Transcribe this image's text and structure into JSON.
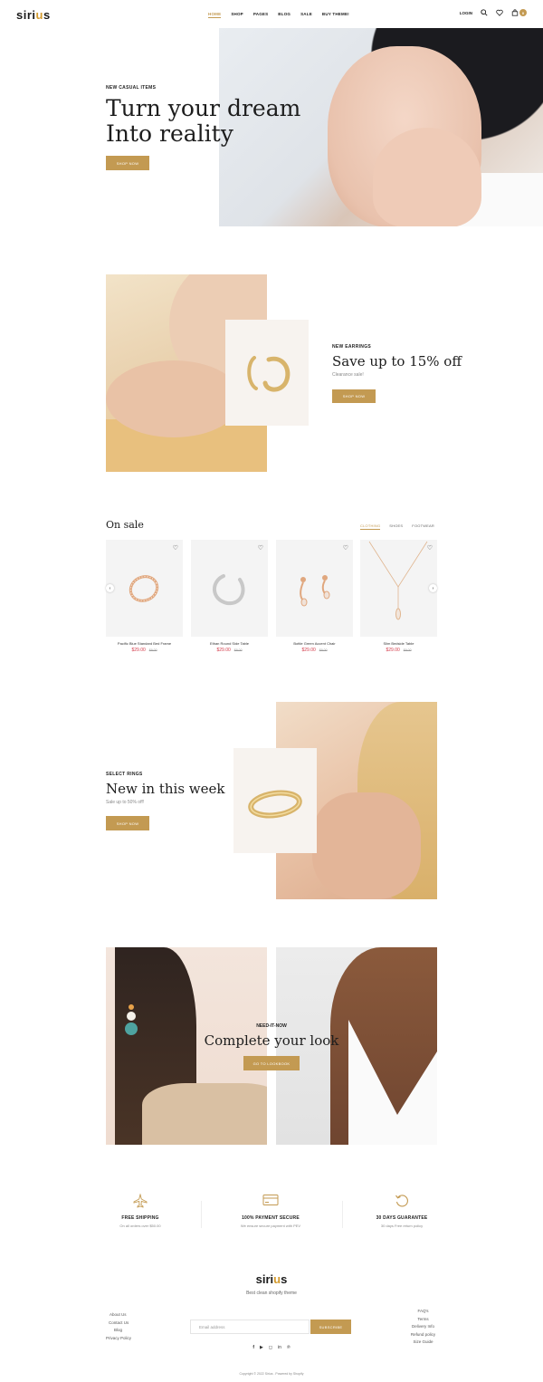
{
  "header": {
    "logo_text": "sirius",
    "logo_accent_color": "#d39a2d",
    "nav": [
      "HOME",
      "SHOP",
      "PAGES",
      "BLOG",
      "SALE",
      "BUY THEME!"
    ],
    "active_nav": "HOME",
    "login_label": "LOGIN",
    "cart_count": "0",
    "icons": [
      "search-icon",
      "heart-icon",
      "bag-icon"
    ]
  },
  "hero": {
    "eyebrow": "NEW CASUAL ITEMS",
    "title_line1": "Turn your dream",
    "title_line2": "Into reality",
    "button": "SHOP NOW"
  },
  "promo_earrings": {
    "eyebrow": "NEW EARRINGS",
    "title": "Save up to 15% off",
    "subtitle": "Clearance sale!",
    "button": "SHOP NOW"
  },
  "on_sale": {
    "title": "On sale",
    "tabs": [
      "CLOTHING",
      "SHOES",
      "FOOTWEAR"
    ],
    "active_tab": "CLOTHING",
    "products": [
      {
        "name": "Pacific Blue Standard Bed Frame",
        "price": "$29.00",
        "old_price": "$9.00"
      },
      {
        "name": "Ethan Round Side Table",
        "price": "$29.00",
        "old_price": "$9.00"
      },
      {
        "name": "Bottle Green Accent Chair",
        "price": "$29.00",
        "old_price": "$9.00"
      },
      {
        "name": "Slim Bedside Table",
        "price": "$29.00",
        "old_price": "$9.00"
      }
    ]
  },
  "new_week": {
    "eyebrow": "SELECT RINGS",
    "title": "New in this week",
    "subtitle": "Sale up to 50% off!",
    "button": "SHOP NOW"
  },
  "lookbook": {
    "eyebrow": "NEED-IT-NOW",
    "title": "Complete your look",
    "button": "GO TO LOOKBOOK"
  },
  "features": [
    {
      "icon": "plane-icon",
      "title": "FREE SHIPPING",
      "subtitle": "On all orders over $50.00"
    },
    {
      "icon": "credit-card-icon",
      "title": "100% PAYMENT SECURE",
      "subtitle": "We ensure secure payment with PEV"
    },
    {
      "icon": "refresh-icon",
      "title": "30 DAYS GUARANTEE",
      "subtitle": "30 days Free return policy"
    }
  ],
  "footer": {
    "logo_text": "sirius",
    "tagline": "Best clean shopify theme",
    "links_left": [
      "About Us",
      "Contact Us",
      "Blog",
      "Privacy Policy"
    ],
    "email_placeholder": "Email address",
    "subscribe": "SUBSCRIBE",
    "links_right": [
      "FAQ's",
      "Terms",
      "Delivery Info",
      "Refund policy",
      "Size Guide"
    ],
    "social": [
      "facebook-icon",
      "youtube-icon",
      "instagram-icon",
      "linkedin-icon",
      "pinterest-icon"
    ],
    "copyright": "Copyright © 2022 Sirius . Powered by Shopify"
  },
  "colors": {
    "accent": "#c39a52",
    "sale_price": "#d33b4a"
  }
}
